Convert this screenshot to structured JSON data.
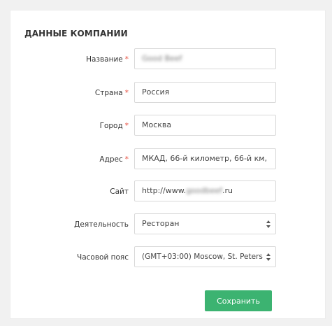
{
  "section": {
    "title": "ДАННЫЕ КОМПАНИИ"
  },
  "form": {
    "fields": [
      {
        "label": "Название",
        "required": "*",
        "value": "Good Beef"
      },
      {
        "label": "Страна",
        "required": "*",
        "value": "Россия"
      },
      {
        "label": "Город",
        "required": "*",
        "value": "Москва"
      },
      {
        "label": "Адрес",
        "required": "*",
        "value": "МКАД, 66-й километр, 66-й км,"
      },
      {
        "label": "Сайт",
        "required": "",
        "value_prefix": "http://www.",
        "value_blurred": "goodbeef",
        "value_suffix": ".ru"
      },
      {
        "label": "Деятельность",
        "required": "",
        "value": "Ресторан"
      },
      {
        "label": "Часовой пояс",
        "required": "",
        "value": "(GMT+03:00) Moscow, St. Peters"
      }
    ],
    "save_label": "Сохранить"
  },
  "colors": {
    "accent": "#3cb371",
    "required": "#e74c3c",
    "background": "#f1f1f1"
  },
  "icons": {
    "select": "select-arrows-icon"
  }
}
